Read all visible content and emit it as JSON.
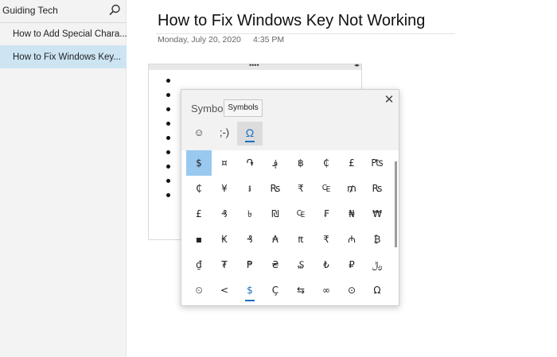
{
  "sidebar": {
    "notebook_title": "Guiding Tech",
    "pages": [
      {
        "label": "How to Add Special Chara..."
      },
      {
        "label": "How to Fix Windows Key..."
      }
    ]
  },
  "page": {
    "title": "How to Fix Windows Key Not Working",
    "date": "Monday, July 20, 2020",
    "time": "4:35 PM"
  },
  "note": {
    "handle_dots": "••••",
    "handle_arrows": "◂▸"
  },
  "symbols_panel": {
    "title": "Symbol",
    "tooltip": "Symbols",
    "close": "✕",
    "category_tabs": [
      {
        "label": "☺",
        "icon": "smiley-icon"
      },
      {
        "label": ";-)",
        "icon": "emoticon"
      },
      {
        "label": "Ω",
        "icon": "omega-icon"
      }
    ],
    "grid": [
      [
        "$",
        "¤",
        "֏",
        "؋",
        "฿",
        "₵",
        "£",
        "₧"
      ],
      [
        "₵",
        "¥",
        "៛",
        "₨",
        "₹",
        "₠",
        "₥",
        "₨"
      ],
      [
        "£",
        "₰",
        "৳",
        "₪",
        "₠",
        "₣",
        "₦",
        "₩"
      ],
      [
        "▪",
        "₭",
        "₰",
        "₳",
        "₶",
        "₹",
        "₼",
        "₿"
      ],
      [
        "₫",
        "₮",
        "₱",
        "₴",
        "₷",
        "₺",
        "₽",
        "﷼"
      ]
    ],
    "bottom_tabs": [
      "⏲",
      "<",
      "$",
      "Ç",
      "⇆",
      "∞",
      "⊙",
      "Ω"
    ],
    "colors": {
      "accent": "#1b6ec2",
      "selected": "#99c9ef",
      "sidebar_selected": "#cde4f3"
    }
  }
}
